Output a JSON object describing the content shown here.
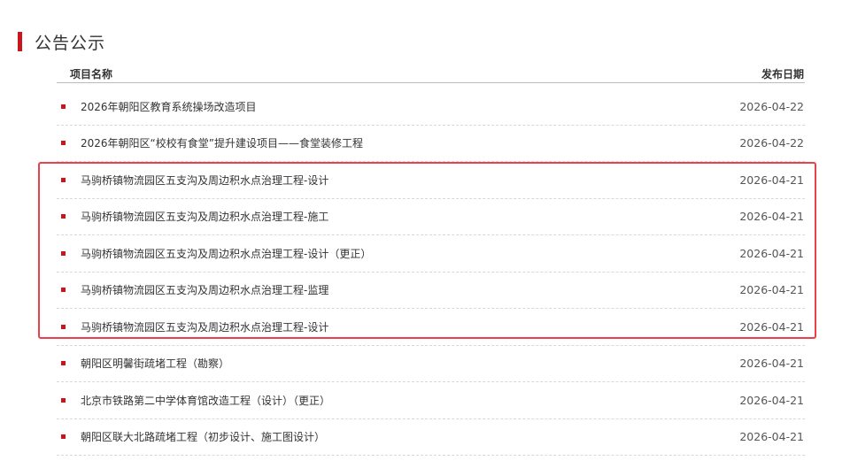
{
  "section": {
    "title": "公告公示"
  },
  "header": {
    "name_label": "项目名称",
    "date_label": "发布日期"
  },
  "colors": {
    "accent": "#c9151e",
    "highlight": "#e8414a"
  },
  "rows": [
    {
      "title": "2026年朝阳区教育系统操场改造项目",
      "date": "2026-04-22"
    },
    {
      "title": "2026年朝阳区“校校有食堂”提升建设项目——食堂装修工程",
      "date": "2026-04-22"
    },
    {
      "title": "马驹桥镇物流园区五支沟及周边积水点治理工程-设计",
      "date": "2026-04-21"
    },
    {
      "title": "马驹桥镇物流园区五支沟及周边积水点治理工程-施工",
      "date": "2026-04-21"
    },
    {
      "title": "马驹桥镇物流园区五支沟及周边积水点治理工程-设计（更正）",
      "date": "2026-04-21"
    },
    {
      "title": "马驹桥镇物流园区五支沟及周边积水点治理工程-监理",
      "date": "2026-04-21"
    },
    {
      "title": "马驹桥镇物流园区五支沟及周边积水点治理工程-设计",
      "date": "2026-04-21"
    },
    {
      "title": "朝阳区明馨街疏堵工程（勘察）",
      "date": "2026-04-21"
    },
    {
      "title": "北京市铁路第二中学体育馆改造工程（设计）（更正）",
      "date": "2026-04-21"
    },
    {
      "title": "朝阳区联大北路疏堵工程（初步设计、施工图设计）",
      "date": "2026-04-21"
    }
  ]
}
